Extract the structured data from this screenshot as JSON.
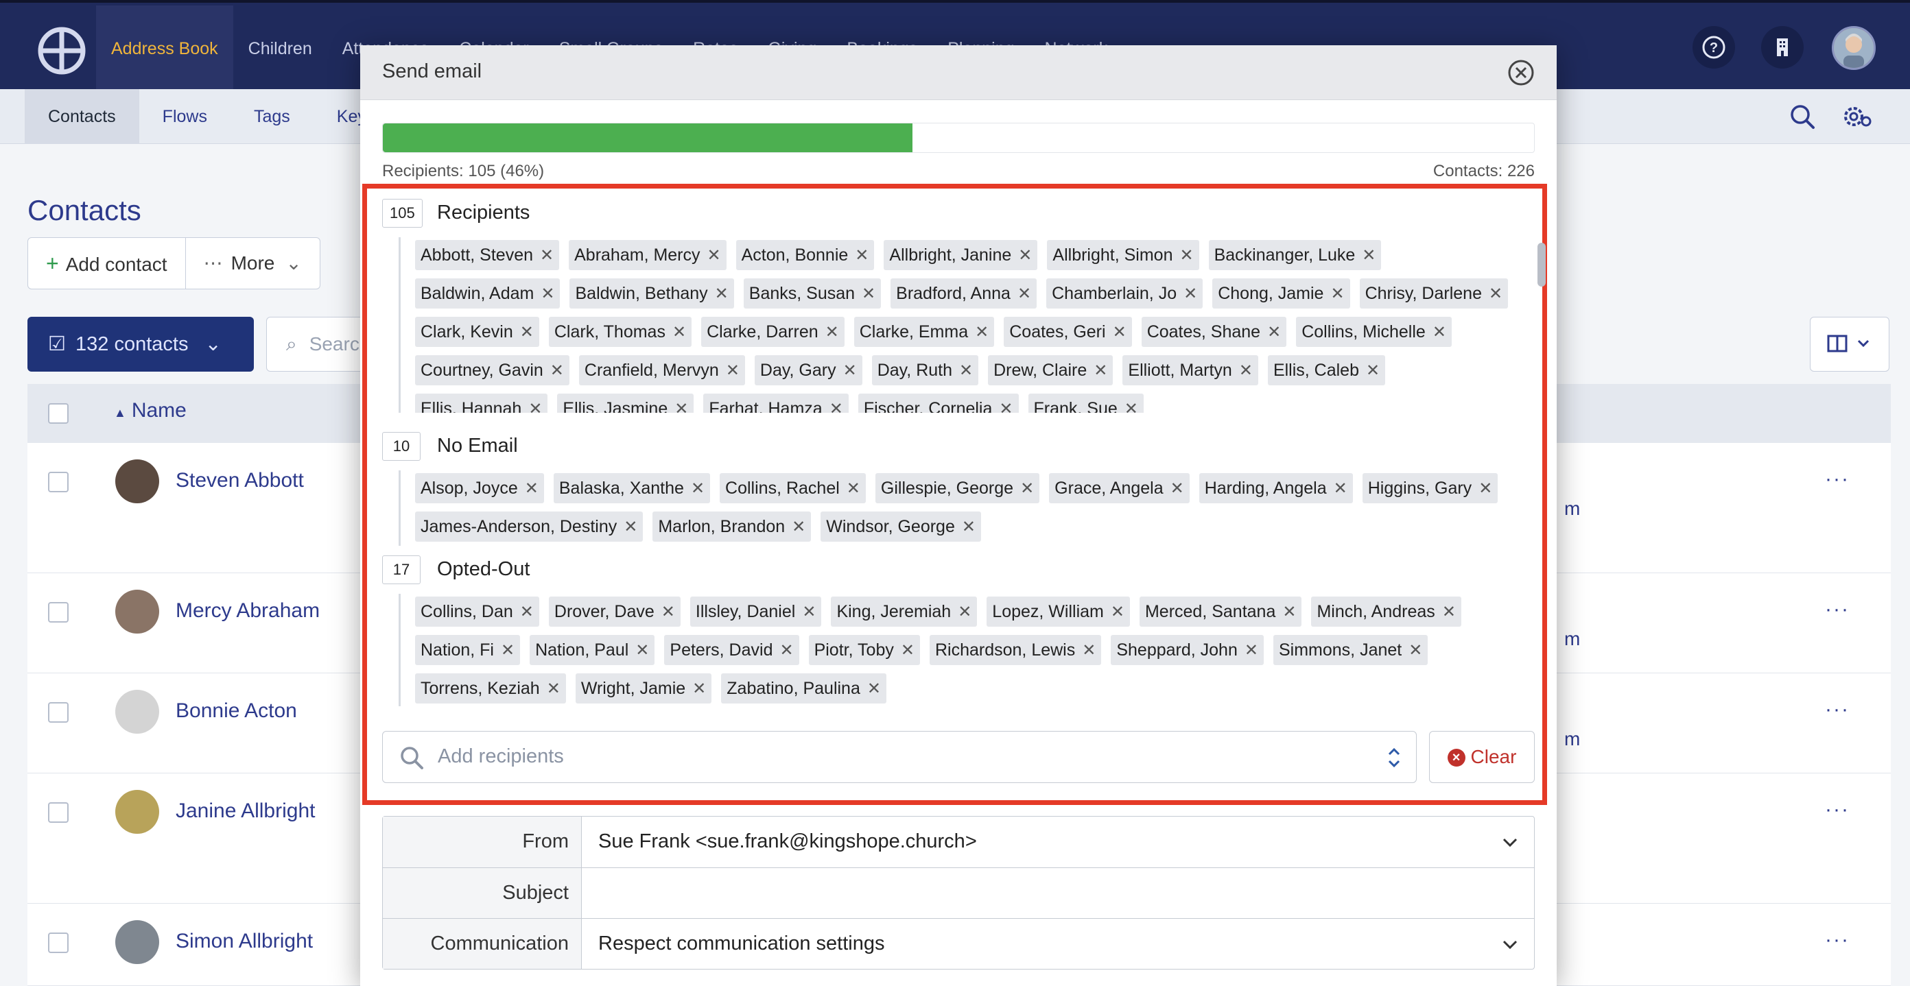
{
  "topnav": {
    "items": [
      "Address Book",
      "Children",
      "Attendance",
      "Calendar",
      "Small Groups",
      "Rotas",
      "Giving",
      "Bookings",
      "Planning",
      "Network"
    ],
    "active": "Address Book"
  },
  "subnav": {
    "items": [
      "Contacts",
      "Flows",
      "Tags",
      "Key"
    ],
    "active": "Contacts"
  },
  "page": {
    "title": "Contacts",
    "add_contact": "Add contact",
    "more": "More",
    "selected_count": "132 contacts",
    "search_placeholder": "Search",
    "name_column": "Name",
    "rows": [
      {
        "name": "Steven Abbott",
        "tail": "m"
      },
      {
        "name": "Mercy Abraham",
        "tail": "m"
      },
      {
        "name": "Bonnie Acton",
        "tail": "m"
      },
      {
        "name": "Janine Allbright",
        "tail": ""
      },
      {
        "name": "Simon Allbright",
        "tail": ""
      }
    ]
  },
  "modal": {
    "title": "Send email",
    "progress_fraction": 0.46,
    "recipients_stat": "Recipients: 105 (46%)",
    "contacts_stat": "Contacts: 226",
    "groups": [
      {
        "count": "105",
        "title": "Recipients",
        "names": [
          "Abbott, Steven",
          "Abraham, Mercy",
          "Acton, Bonnie",
          "Allbright, Janine",
          "Allbright, Simon",
          "Backinanger, Luke",
          "Baldwin, Adam",
          "Baldwin, Bethany",
          "Banks, Susan",
          "Bradford, Anna",
          "Chamberlain, Jo",
          "Chong, Jamie",
          "Chrisy, Darlene",
          "Clark, Kevin",
          "Clark, Thomas",
          "Clarke, Darren",
          "Clarke, Emma",
          "Coates, Geri",
          "Coates, Shane",
          "Collins, Michelle",
          "Courtney, Gavin",
          "Cranfield, Mervyn",
          "Day, Gary",
          "Day, Ruth",
          "Drew, Claire",
          "Elliott, Martyn",
          "Ellis, Caleb",
          "Ellis, Hannah",
          "Ellis, Jasmine",
          "Farhat, Hamza",
          "Fischer, Cornelia",
          "Frank, Sue"
        ]
      },
      {
        "count": "10",
        "title": "No Email",
        "names": [
          "Alsop, Joyce",
          "Balaska, Xanthe",
          "Collins, Rachel",
          "Gillespie, George",
          "Grace, Angela",
          "Harding, Angela",
          "Higgins, Gary",
          "James-Anderson, Destiny",
          "Marlon, Brandon",
          "Windsor, George"
        ]
      },
      {
        "count": "17",
        "title": "Opted-Out",
        "names": [
          "Collins, Dan",
          "Drover, Dave",
          "Illsley, Daniel",
          "King, Jeremiah",
          "Lopez, William",
          "Merced, Santana",
          "Minch, Andreas",
          "Nation, Fi",
          "Nation, Paul",
          "Peters, David",
          "Piotr, Toby",
          "Richardson, Lewis",
          "Sheppard, John",
          "Simmons, Janet",
          "Torrens, Keziah",
          "Wright, Jamie",
          "Zabatino, Paulina"
        ]
      }
    ],
    "add_recipients_placeholder": "Add recipients",
    "clear_label": "Clear",
    "form": {
      "from_label": "From",
      "from_value": "Sue Frank <sue.frank@kingshope.church>",
      "subject_label": "Subject",
      "subject_value": "",
      "communication_label": "Communication",
      "communication_value": "Respect communication settings"
    }
  },
  "colors": {
    "nav_bg": "#1f2a5c",
    "nav_active": "#f0b53b",
    "progress": "#4caf50",
    "highlight": "#e53a27",
    "link": "#2d3a8c"
  }
}
